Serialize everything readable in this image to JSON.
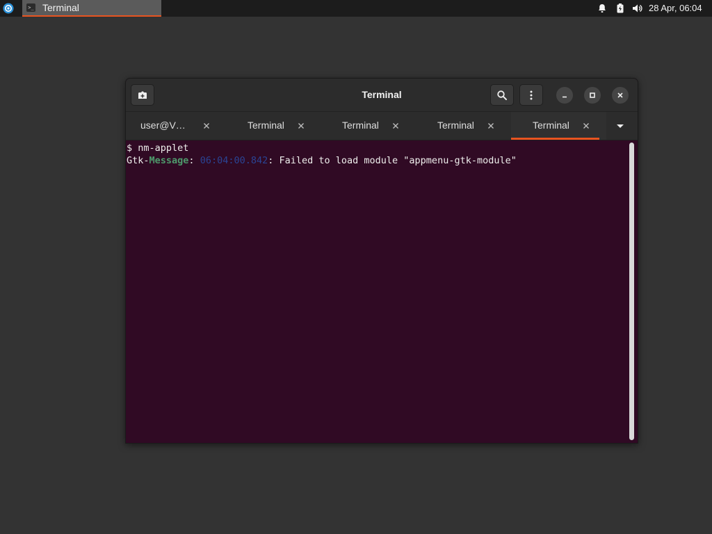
{
  "taskbar": {
    "task_label": "Terminal",
    "task_icon_glyph": ">_",
    "clock": "28 Apr, 06:04",
    "icons": [
      "app-menu-icon",
      "bell-icon",
      "battery-icon",
      "volume-icon"
    ]
  },
  "window": {
    "title": "Terminal",
    "tabs": [
      {
        "label": "user@V…",
        "active": false
      },
      {
        "label": "Terminal",
        "active": false
      },
      {
        "label": "Terminal",
        "active": false
      },
      {
        "label": "Terminal",
        "active": false
      },
      {
        "label": "Terminal",
        "active": true
      }
    ]
  },
  "terminal": {
    "line1": "$ nm-applet",
    "line2": {
      "part1": "Gtk-",
      "part2": "Message",
      "part3": ": ",
      "timestamp": "06:04:00.842",
      "part5": ": Failed to load module \"appmenu-gtk-module\""
    }
  },
  "colors": {
    "accent": "#e95420",
    "terminal_bg": "#300a24",
    "message_green": "#4e9a6c",
    "timestamp_blue": "#2a4494"
  }
}
